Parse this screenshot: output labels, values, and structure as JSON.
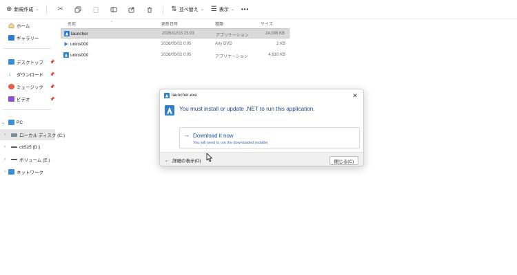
{
  "toolbar": {
    "new_label": "新規作成",
    "sort_label": "並べ替え",
    "view_label": "表示",
    "more_label": "•••"
  },
  "sidebar": {
    "home": "ホーム",
    "gallery": "ギャラリー",
    "desktop": "デスクトップ",
    "downloads": "ダウンロード",
    "music": "ミュージック",
    "videos": "ビデオ",
    "pc": "PC",
    "local_disk": "ローカル ディスク (C:)",
    "ctt525": "ctt525 (D:)",
    "volume": "ボリューム (E:)",
    "network": "ネットワーク"
  },
  "columns": {
    "name": "名前",
    "modified": "更新日時",
    "type": "種類",
    "size": "サイズ"
  },
  "files": [
    {
      "name": "launcher",
      "date": "2026/02/15 23:03",
      "type": "アプリケーション",
      "size": "24,098 KB",
      "icon": "launcher-app-icon",
      "selected": true
    },
    {
      "name": "unins000",
      "date": "2026/05/02 0:05",
      "type": "Any DVD",
      "size": "2 KB",
      "icon": "dat-file-icon",
      "selected": false
    },
    {
      "name": "unins000",
      "date": "2026/05/02 0:05",
      "type": "アプリケーション",
      "size": "4,610 KB",
      "icon": "app-icon",
      "selected": false
    }
  ],
  "dialog": {
    "title": "launcher.exe",
    "message": "You must install or update .NET to run this application.",
    "command_label": "Download it now",
    "command_note": "You will need to run the downloaded installer",
    "details_label": "詳細の表示(D)",
    "close_label": "閉じる(C)",
    "close_glyph": "✕"
  },
  "colors": {
    "accent_blue": "#1a4ea8",
    "message_blue": "#1f3f8a",
    "selection_gray": "#d9d9d9"
  }
}
